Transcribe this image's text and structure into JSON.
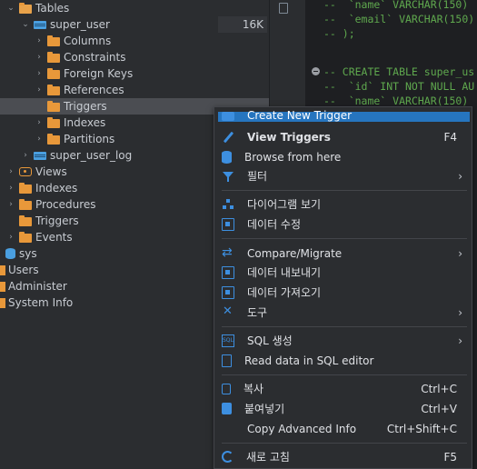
{
  "tree": {
    "rows": [
      {
        "label": "Tables"
      },
      {
        "label": "super_user",
        "size": "16K"
      },
      {
        "label": "Columns"
      },
      {
        "label": "Constraints"
      },
      {
        "label": "Foreign Keys"
      },
      {
        "label": "References"
      },
      {
        "label": "Triggers"
      },
      {
        "label": "Indexes"
      },
      {
        "label": "Partitions"
      },
      {
        "label": "super_user_log"
      },
      {
        "label": "Views"
      },
      {
        "label": "Indexes"
      },
      {
        "label": "Procedures"
      },
      {
        "label": "Triggers"
      },
      {
        "label": "Events"
      },
      {
        "label": "sys"
      },
      {
        "label": "Users"
      },
      {
        "label": "Administer"
      },
      {
        "label": "System Info"
      }
    ]
  },
  "editor": {
    "lines": [
      "--  `name` VARCHAR(150)",
      "--  `email` VARCHAR(150)",
      "-- );",
      "-- CREATE TABLE super_us",
      "--  `id` INT NOT NULL AU",
      "--  `name` VARCHAR(150)"
    ]
  },
  "menu": {
    "items": [
      {
        "label": "Create New Trigger",
        "icon": "trigger-icon"
      },
      {
        "label": "View Triggers",
        "shortcut": "F4",
        "icon": "pencil-icon"
      },
      {
        "label": "Browse from here",
        "icon": "database-icon"
      },
      {
        "label": "필터",
        "icon": "filter-icon"
      },
      {
        "label": "다이어그램 보기",
        "icon": "diagram-icon"
      },
      {
        "label": "데이터 수정",
        "icon": "edit-data-icon"
      },
      {
        "label": "Compare/Migrate",
        "icon": "compare-icon"
      },
      {
        "label": "데이터 내보내기",
        "icon": "export-icon"
      },
      {
        "label": "데이터 가져오기",
        "icon": "import-icon"
      },
      {
        "label": "도구",
        "icon": "tools-icon"
      },
      {
        "label": "SQL 생성",
        "icon": "sql-icon"
      },
      {
        "label": "Read data in SQL editor",
        "icon": "read-sql-icon"
      },
      {
        "label": "복사",
        "shortcut": "Ctrl+C",
        "icon": "copy-icon"
      },
      {
        "label": "붙여넣기",
        "shortcut": "Ctrl+V",
        "icon": "paste-icon"
      },
      {
        "label": "Copy Advanced Info",
        "shortcut": "Ctrl+Shift+C"
      },
      {
        "label": "새로 고침",
        "shortcut": "F5",
        "icon": "refresh-icon"
      }
    ],
    "submenu_arrow": "›"
  },
  "colors": {
    "selection": "#2675bf",
    "folder": "#e8983a",
    "table_icon": "#4a9fe0",
    "comment_text": "#5fa84e"
  }
}
